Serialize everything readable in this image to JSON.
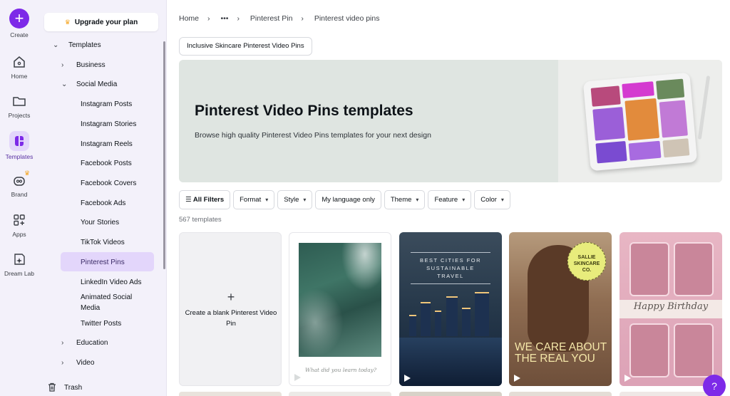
{
  "rail": {
    "create": "Create",
    "home": "Home",
    "projects": "Projects",
    "templates": "Templates",
    "brand": "Brand",
    "apps": "Apps",
    "dreamlab": "Dream Lab"
  },
  "sidebar": {
    "upgrade": "Upgrade your plan",
    "templates": "Templates",
    "business": "Business",
    "social_media": "Social Media",
    "items": [
      "Instagram Posts",
      "Instagram Stories",
      "Instagram Reels",
      "Facebook Posts",
      "Facebook Covers",
      "Facebook Ads",
      "Your Stories",
      "TikTok Videos",
      "Pinterest Pins",
      "LinkedIn Video Ads",
      "Animated Social",
      "Media",
      "Twitter Posts"
    ],
    "education": "Education",
    "video": "Video",
    "trash": "Trash"
  },
  "breadcrumb": {
    "home": "Home",
    "more": "•••",
    "pinterest_pin": "Pinterest Pin",
    "current": "Pinterest video pins"
  },
  "chip": "Inclusive Skincare Pinterest Video Pins",
  "banner": {
    "title": "Pinterest Video Pins templates",
    "subtitle": "Browse high quality Pinterest Video Pins templates for your next design"
  },
  "filters": {
    "all": "All Filters",
    "format": "Format",
    "style": "Style",
    "language": "My language only",
    "theme": "Theme",
    "feature": "Feature",
    "color": "Color"
  },
  "count": "567 templates",
  "cards": {
    "blank_line1": "Create a blank Pinterest Video",
    "blank_line2": "Pin",
    "ocean_script": "What did you learn today?",
    "city_line1": "BEST CITIES FOR",
    "city_line2": "SUSTAINABLE",
    "city_line3": "TRAVEL",
    "badge_line1": "SALLIE",
    "badge_line2": "SKINCARE",
    "badge_line3": "CO.",
    "slogan_line1": "WE CARE ABOUT",
    "slogan_line2": "THE REAL YOU",
    "bday": "Happy Birthday"
  },
  "help": "?",
  "colors": {
    "accent": "#7d2ae8",
    "selected": "#e3d6fb",
    "sidebar_bg": "#f3f1fa",
    "crown": "#f4a623"
  }
}
